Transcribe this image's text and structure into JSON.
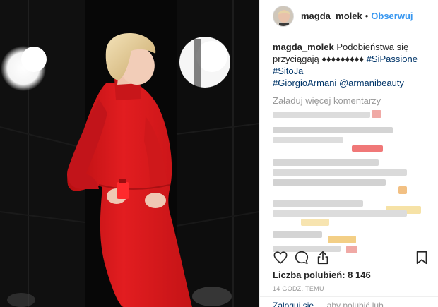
{
  "post": {
    "username": "magda_molek",
    "separator": "•",
    "follow_label": "Obserwuj"
  },
  "caption": {
    "username": "magda_molek",
    "text_1": "Podobieństwa się",
    "text_2": "przyciągają ♦♦♦♦♦♦♦♦♦",
    "tag_1": "#SiPassione",
    "tag_2": "#SitoJa",
    "tag_3": "#GiorgioArmani",
    "tag_4": "@armanibeauty"
  },
  "comments": {
    "load_more_label": "Załaduj więcej komentarzy"
  },
  "actions": {
    "like_icon": "heart-icon",
    "comment_icon": "comment-bubble-icon",
    "share_icon": "share-icon",
    "save_icon": "bookmark-icon"
  },
  "likes": {
    "text": "Liczba polubień: 8 146"
  },
  "timestamp": {
    "text": "14 GODZ. TEMU"
  },
  "footer": {
    "login_label": "Zaloguj się",
    "login_rest": ", aby polubić lub"
  },
  "colors": {
    "accent": "#3897f0",
    "link": "#003569",
    "muted": "#999999",
    "text": "#262626",
    "dress": "#e01b1e"
  }
}
